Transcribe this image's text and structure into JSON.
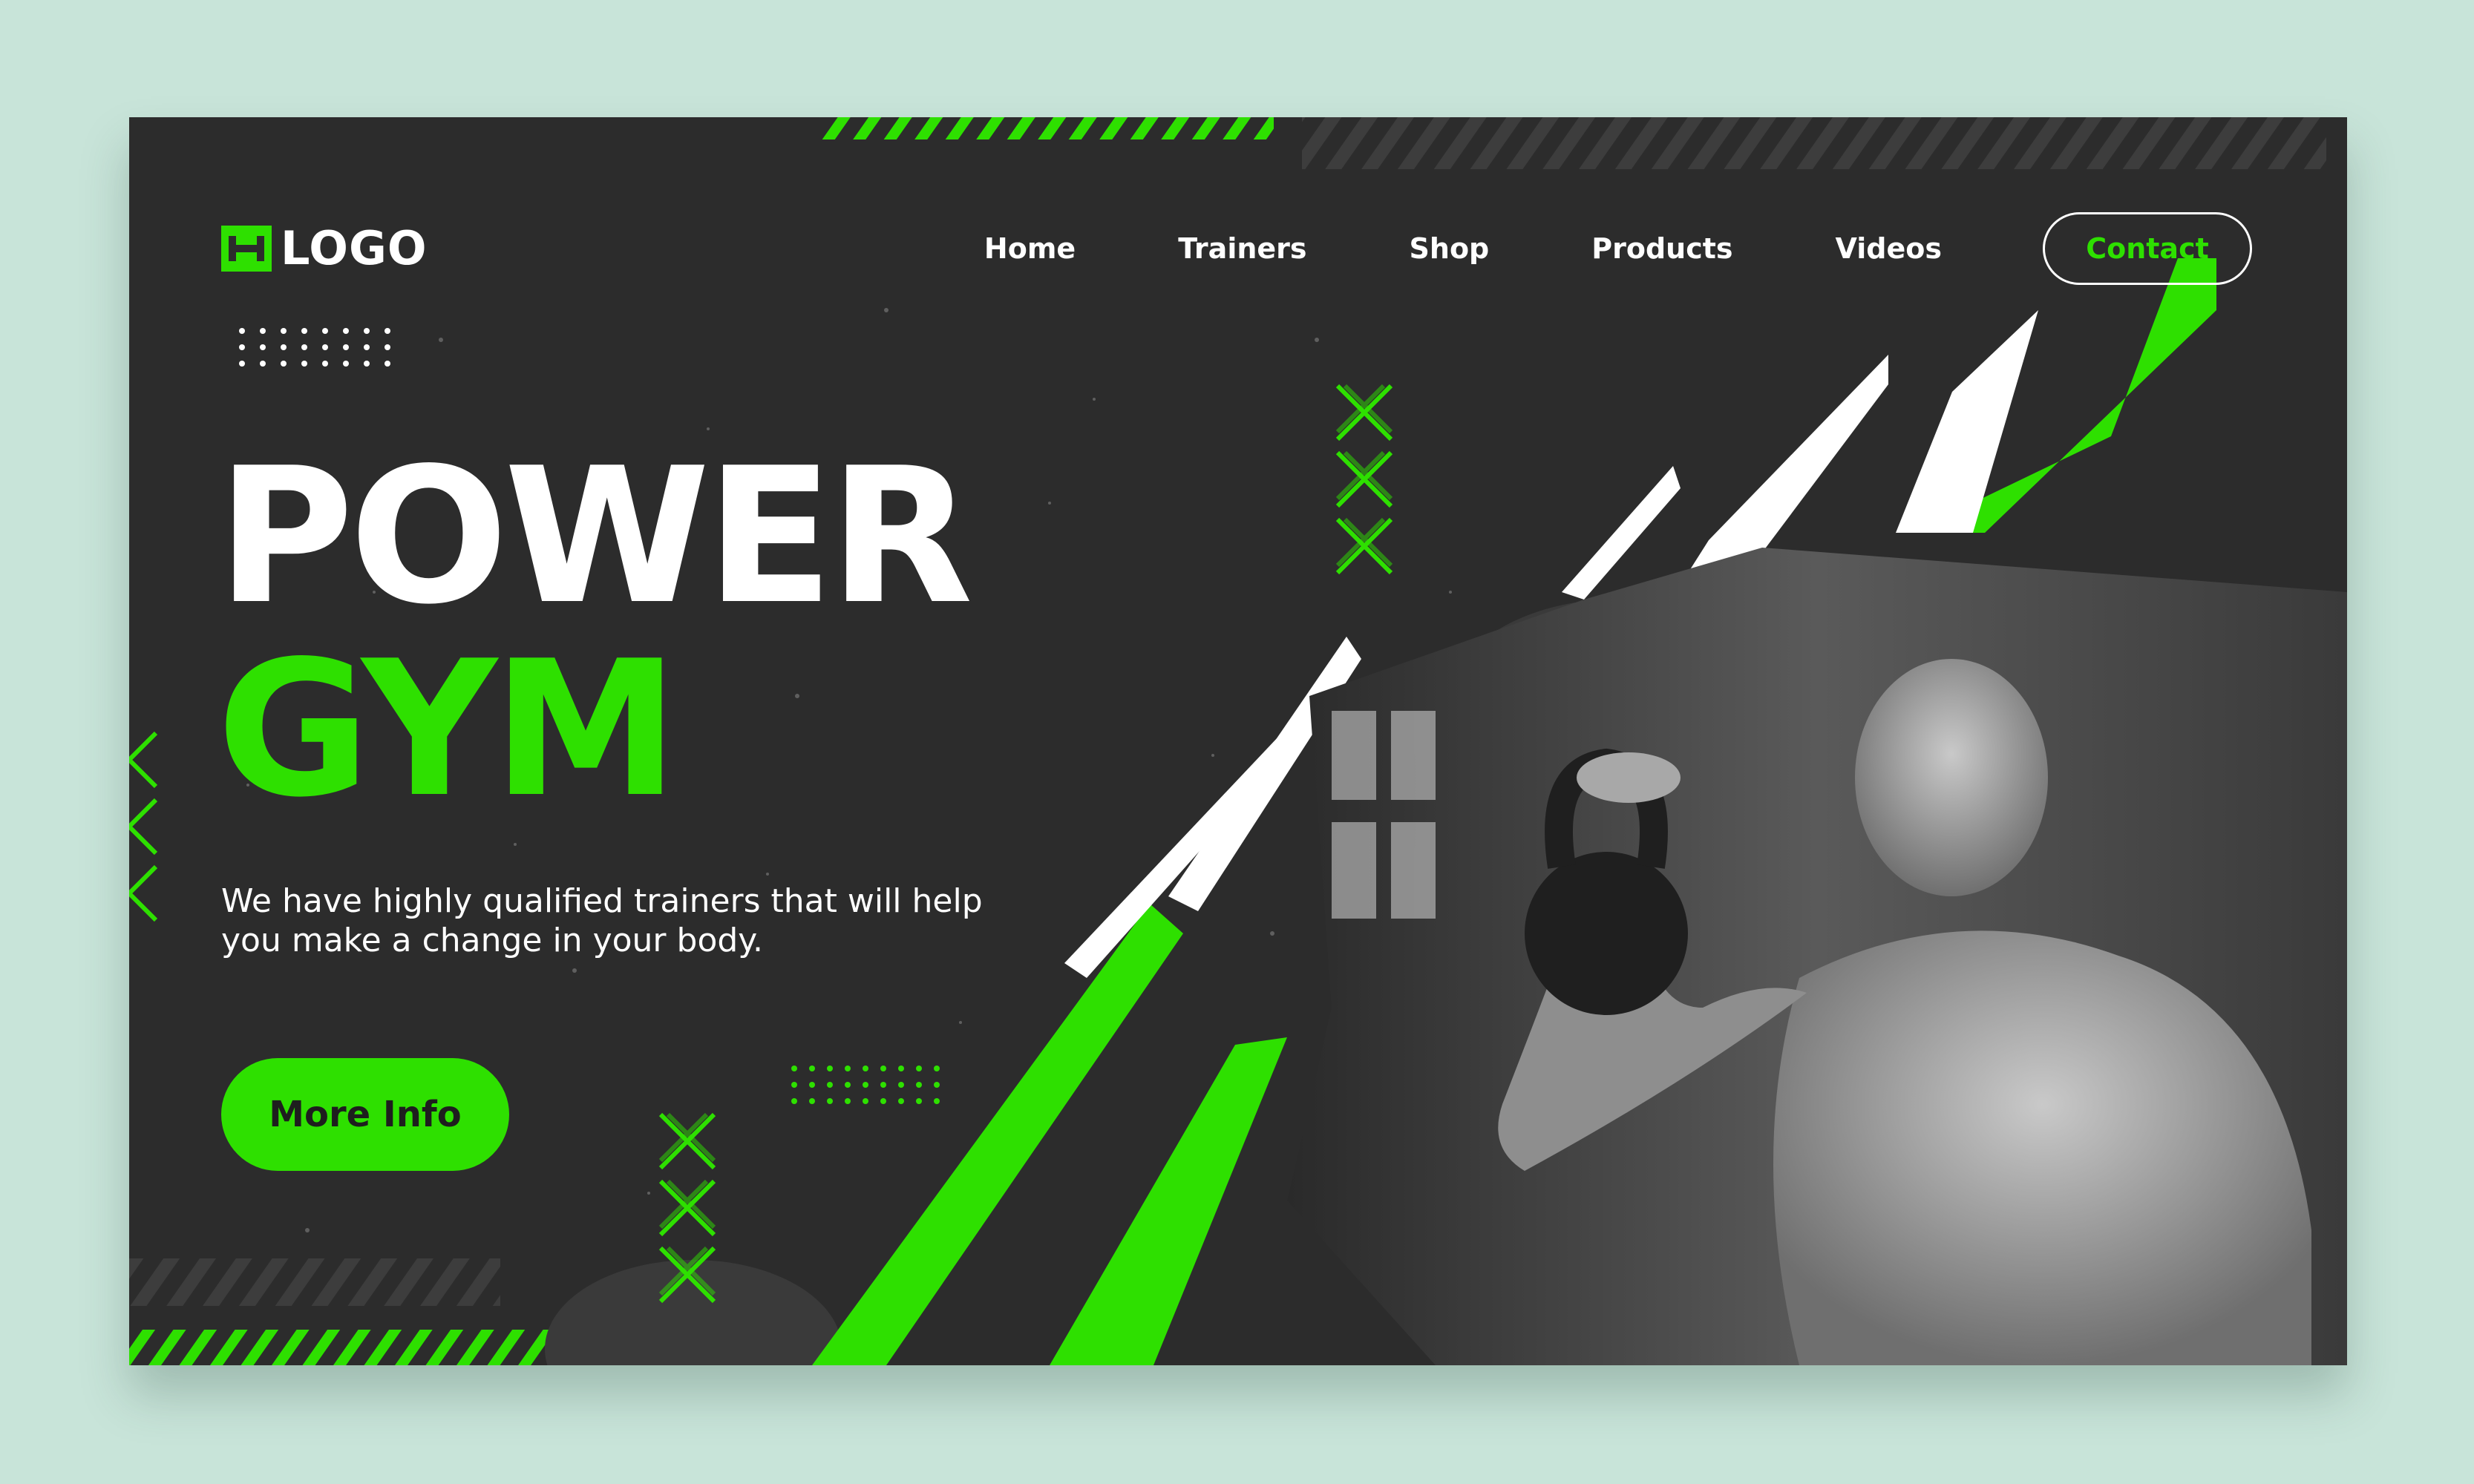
{
  "brand": {
    "logo_text": "LOGO"
  },
  "nav": {
    "items": [
      "Home",
      "Trainers",
      "Shop",
      "Products",
      "Videos"
    ],
    "contact_label": "Contact"
  },
  "hero": {
    "title_line1": "POWER",
    "title_line2": "GYM",
    "description": "We have highly qualified trainers that will help you make a change in your body.",
    "cta_label": "More Info"
  },
  "colors": {
    "accent": "#2ee000",
    "background": "#c8e4d9",
    "panel": "#2c2c2c"
  },
  "icons": [
    "dumbbell-icon",
    "x-mark-icon"
  ]
}
